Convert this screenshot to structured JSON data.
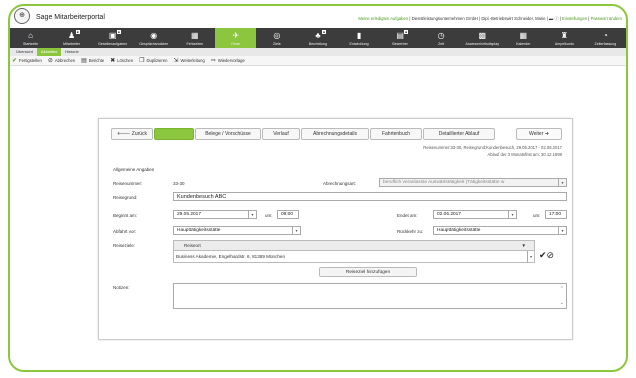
{
  "app": {
    "title": "Sage Mitarbeiterportal"
  },
  "userbar": {
    "tasks_link": "Meine erledigten Aufgaben",
    "user_text": "| Dienstleistungsunternehmen GmbH | Dipl.-Betriebswirt Schneider, Marie |",
    "settings_link": "Einstellungen",
    "password_link": "Passwort ändern"
  },
  "nav": {
    "items": [
      {
        "label": "Startseite",
        "icon": "⌂"
      },
      {
        "label": "Mitarbeiter",
        "icon": "♟"
      },
      {
        "label": "Gesellenaufgaben",
        "icon": "▣"
      },
      {
        "label": "Gesprächsnotizen",
        "icon": "◉"
      },
      {
        "label": "Fehlzeiten",
        "icon": "▦"
      },
      {
        "label": "Reise",
        "icon": "✈"
      },
      {
        "label": "Ziele",
        "icon": "◎"
      },
      {
        "label": "Beurteilung",
        "icon": "♣"
      },
      {
        "label": "Entwicklung",
        "icon": "▮"
      },
      {
        "label": "Bewerber",
        "icon": "▤"
      },
      {
        "label": "Zeit",
        "icon": "◷"
      },
      {
        "label": "Anwesenheitsdisplay",
        "icon": "▩"
      },
      {
        "label": "Kalender",
        "icon": "▦"
      },
      {
        "label": "Ampelkonto",
        "icon": "♜"
      },
      {
        "label": "Zeiterfassung",
        "icon": "◔"
      }
    ]
  },
  "subtabs": [
    "Übersicht",
    "Aktuelles",
    "Historie"
  ],
  "actions": [
    "Fertigstellen",
    "Abbrechen",
    "Berichte",
    "Löschen",
    "Duplizieren",
    "Weiterleitung",
    "Wiedervorlage"
  ],
  "form_tabs": {
    "back": "Zurück",
    "items": [
      "Reisedaten",
      "Belege / Vorschüsse",
      "Verlauf",
      "Abrechnungsdetails",
      "Fahrtenbuch",
      "Detaillierter Ablauf"
    ],
    "next": "Weiter"
  },
  "meta": {
    "line1": "Reisenummer:33-30, Reisegrund:Kundenbesuch, 29.05.2017 - 02.06.2017",
    "line2": "Ablauf der 3 Monatsfrist am: 30.12.1899"
  },
  "form": {
    "section": "Allgemeine Angaben",
    "reisenummer_label": "Reisenummer:",
    "reisenummer": "33-30",
    "abrechnungsart_label": "Abrechnungsart:",
    "abrechnungsart": "beruflich veranlasste Auswärtstätigkeit (Tätigkeitsstätte w",
    "reisegrund_label": "Reisegrund:",
    "reisegrund": "Kundenbesuch ABC",
    "beginn_label": "Beginnt am:",
    "beginn_date": "29.05.2017",
    "um_label": "um:",
    "beginn_time": "09:00",
    "ende_label": "Endet am:",
    "ende_date": "02.06.2017",
    "ende_time": "17:00",
    "abfahrt_label": "Abfahrt vor:",
    "abfahrt": "Haupttätigkeitsstätte",
    "rueckkehr_label": "Rückkehr zu:",
    "rueckkehr": "Haupttätigkeitsstätte",
    "reiseziele_label": "Reiseziele:",
    "reiseort_header": "Reiseort",
    "reiseort_value": "Business Akademie, Engelhardstr. 6, 81369 München",
    "add_button": "Reiseziel hinzufügen",
    "notizen_label": "Notizen:"
  },
  "colors": {
    "accent": "#8cc63f",
    "navbar": "#3c3c3c"
  }
}
